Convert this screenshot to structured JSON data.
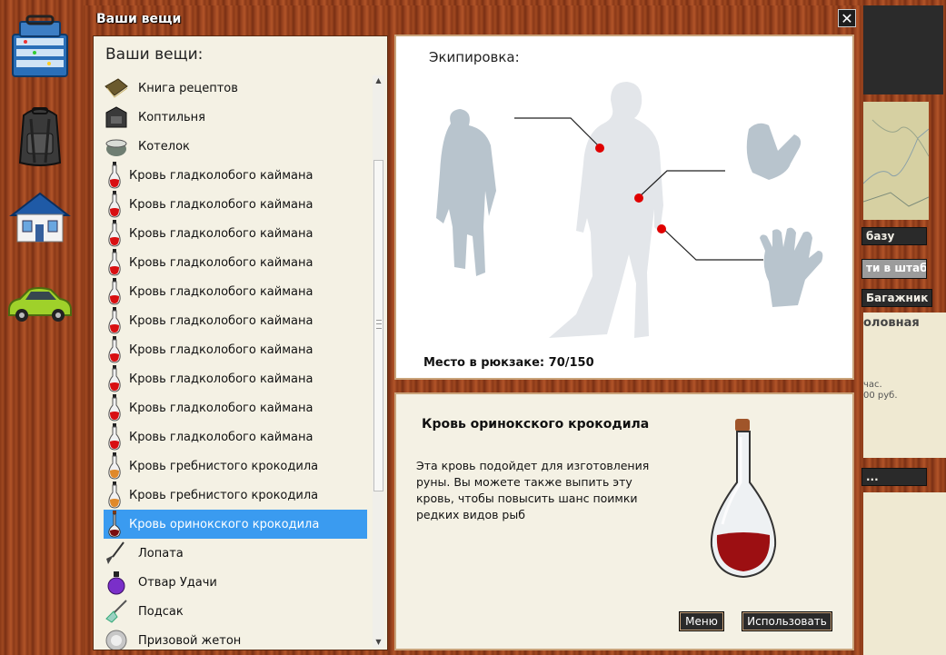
{
  "dialog": {
    "title": "Ваши вещи",
    "close_icon": "✕"
  },
  "inventory": {
    "heading": "Ваши вещи:",
    "items": [
      {
        "label": "Книга рецептов",
        "icon": "recipe-book-icon"
      },
      {
        "label": "Коптильня",
        "icon": "smokehouse-icon"
      },
      {
        "label": "Котелок",
        "icon": "pot-icon"
      },
      {
        "label": "Кровь гладколобого каймана",
        "icon": "blood-flask-icon"
      },
      {
        "label": "Кровь гладколобого каймана",
        "icon": "blood-flask-icon"
      },
      {
        "label": "Кровь гладколобого каймана",
        "icon": "blood-flask-icon"
      },
      {
        "label": "Кровь гладколобого каймана",
        "icon": "blood-flask-icon"
      },
      {
        "label": "Кровь гладколобого каймана",
        "icon": "blood-flask-icon"
      },
      {
        "label": "Кровь гладколобого каймана",
        "icon": "blood-flask-icon"
      },
      {
        "label": "Кровь гладколобого каймана",
        "icon": "blood-flask-icon"
      },
      {
        "label": "Кровь гладколобого каймана",
        "icon": "blood-flask-icon"
      },
      {
        "label": "Кровь гладколобого каймана",
        "icon": "blood-flask-icon"
      },
      {
        "label": "Кровь гладколобого каймана",
        "icon": "blood-flask-icon"
      },
      {
        "label": "Кровь гребнистого крокодила",
        "icon": "orange-flask-icon"
      },
      {
        "label": "Кровь гребнистого крокодила",
        "icon": "orange-flask-icon"
      },
      {
        "label": "Кровь оринокского крокодила",
        "icon": "dark-flask-icon",
        "selected": true
      },
      {
        "label": "Лопата",
        "icon": "shovel-icon"
      },
      {
        "label": "Отвар Удачи",
        "icon": "potion-icon"
      },
      {
        "label": "Подсак",
        "icon": "landing-net-icon"
      },
      {
        "label": "Призовой жетон",
        "icon": "token-icon"
      }
    ]
  },
  "equipment": {
    "heading": "Экипировка:",
    "backpack_label": "Место в рюкзаке: 70/150"
  },
  "detail": {
    "title": "Кровь оринокского крокодила",
    "description": "Эта кровь подойдет для изготовления руны. Вы можете также выпить эту кровь, чтобы повысить шанс поимки редких видов рыб",
    "menu_button": "Меню",
    "use_button": "Использовать"
  },
  "right_panel": {
    "base_button": "базу",
    "hq_button": "ти в штаб",
    "trunk_button": "Багажник",
    "card_title": "оловная",
    "card_line1": "час.",
    "card_line2": "00 руб.",
    "more_button": "..."
  },
  "colors": {
    "selection": "#3a9bf0",
    "marker": "#e00000",
    "silhouette": "#b8c4cd"
  }
}
